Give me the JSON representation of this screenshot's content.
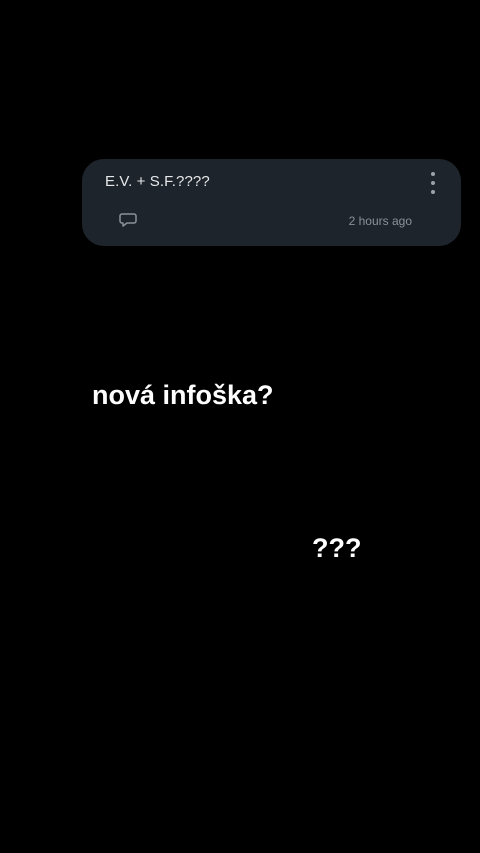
{
  "comment": {
    "text": "E.V. + S.F.????",
    "timestamp": "2 hours ago",
    "reply_icon": "speech-bubble-icon",
    "more_icon": "vertical-ellipsis-icon"
  },
  "captions": [
    {
      "text": "nová infoška?"
    },
    {
      "text": "???"
    }
  ],
  "colors": {
    "background": "#000000",
    "card": "#1e242b",
    "caption_text": "#ffffff",
    "timestamp": "#8a9198"
  }
}
